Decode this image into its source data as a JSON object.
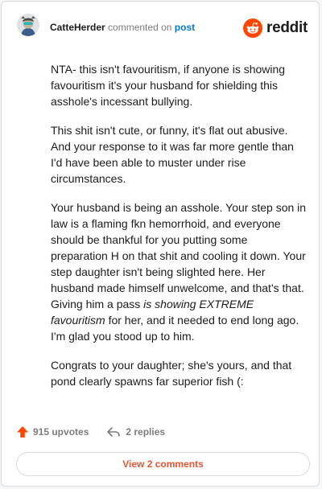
{
  "comment": {
    "username": "CatteHerder",
    "action": "commented on",
    "target": "post",
    "paragraphs": [
      [
        {
          "text": "NTA- this isn't favouritism, if anyone is showing favouritism it's your husband for shielding this asshole's incessant bullying."
        }
      ],
      [
        {
          "text": "This shit isn't cute, or funny, it's flat out abusive. And your response to it was far more gentle than I'd have been able to muster under rise circumstances."
        }
      ],
      [
        {
          "text": "Your husband is being an asshole. Your step son in law is a flaming fkn hemorrhoid, and everyone should be thankful for you putting some preparation H on that shit and cooling it down. Your step daughter isn't being slighted here. Her husband made himself unwelcome, and that's that. Giving him a pass "
        },
        {
          "text": "is showing EXTREME favouritism",
          "italic": true
        },
        {
          "text": " for her, and it needed to end long ago. I'm glad you stood up to him."
        }
      ],
      [
        {
          "text": "Congrats to your daughter; she's yours, and that pond clearly spawns far superior fish (:"
        }
      ]
    ]
  },
  "footer": {
    "upvotes_label": "915 upvotes",
    "replies_label": "2 replies",
    "view_comments_label": "View 2 comments"
  },
  "brand": {
    "wordmark": "reddit",
    "accent": "#ff4500",
    "link": "#0079d3"
  },
  "icons": {
    "upvote": "upvote-arrow-icon",
    "reply": "reply-arrow-icon",
    "logo": "reddit-snoo-icon",
    "avatar": "user-avatar"
  }
}
